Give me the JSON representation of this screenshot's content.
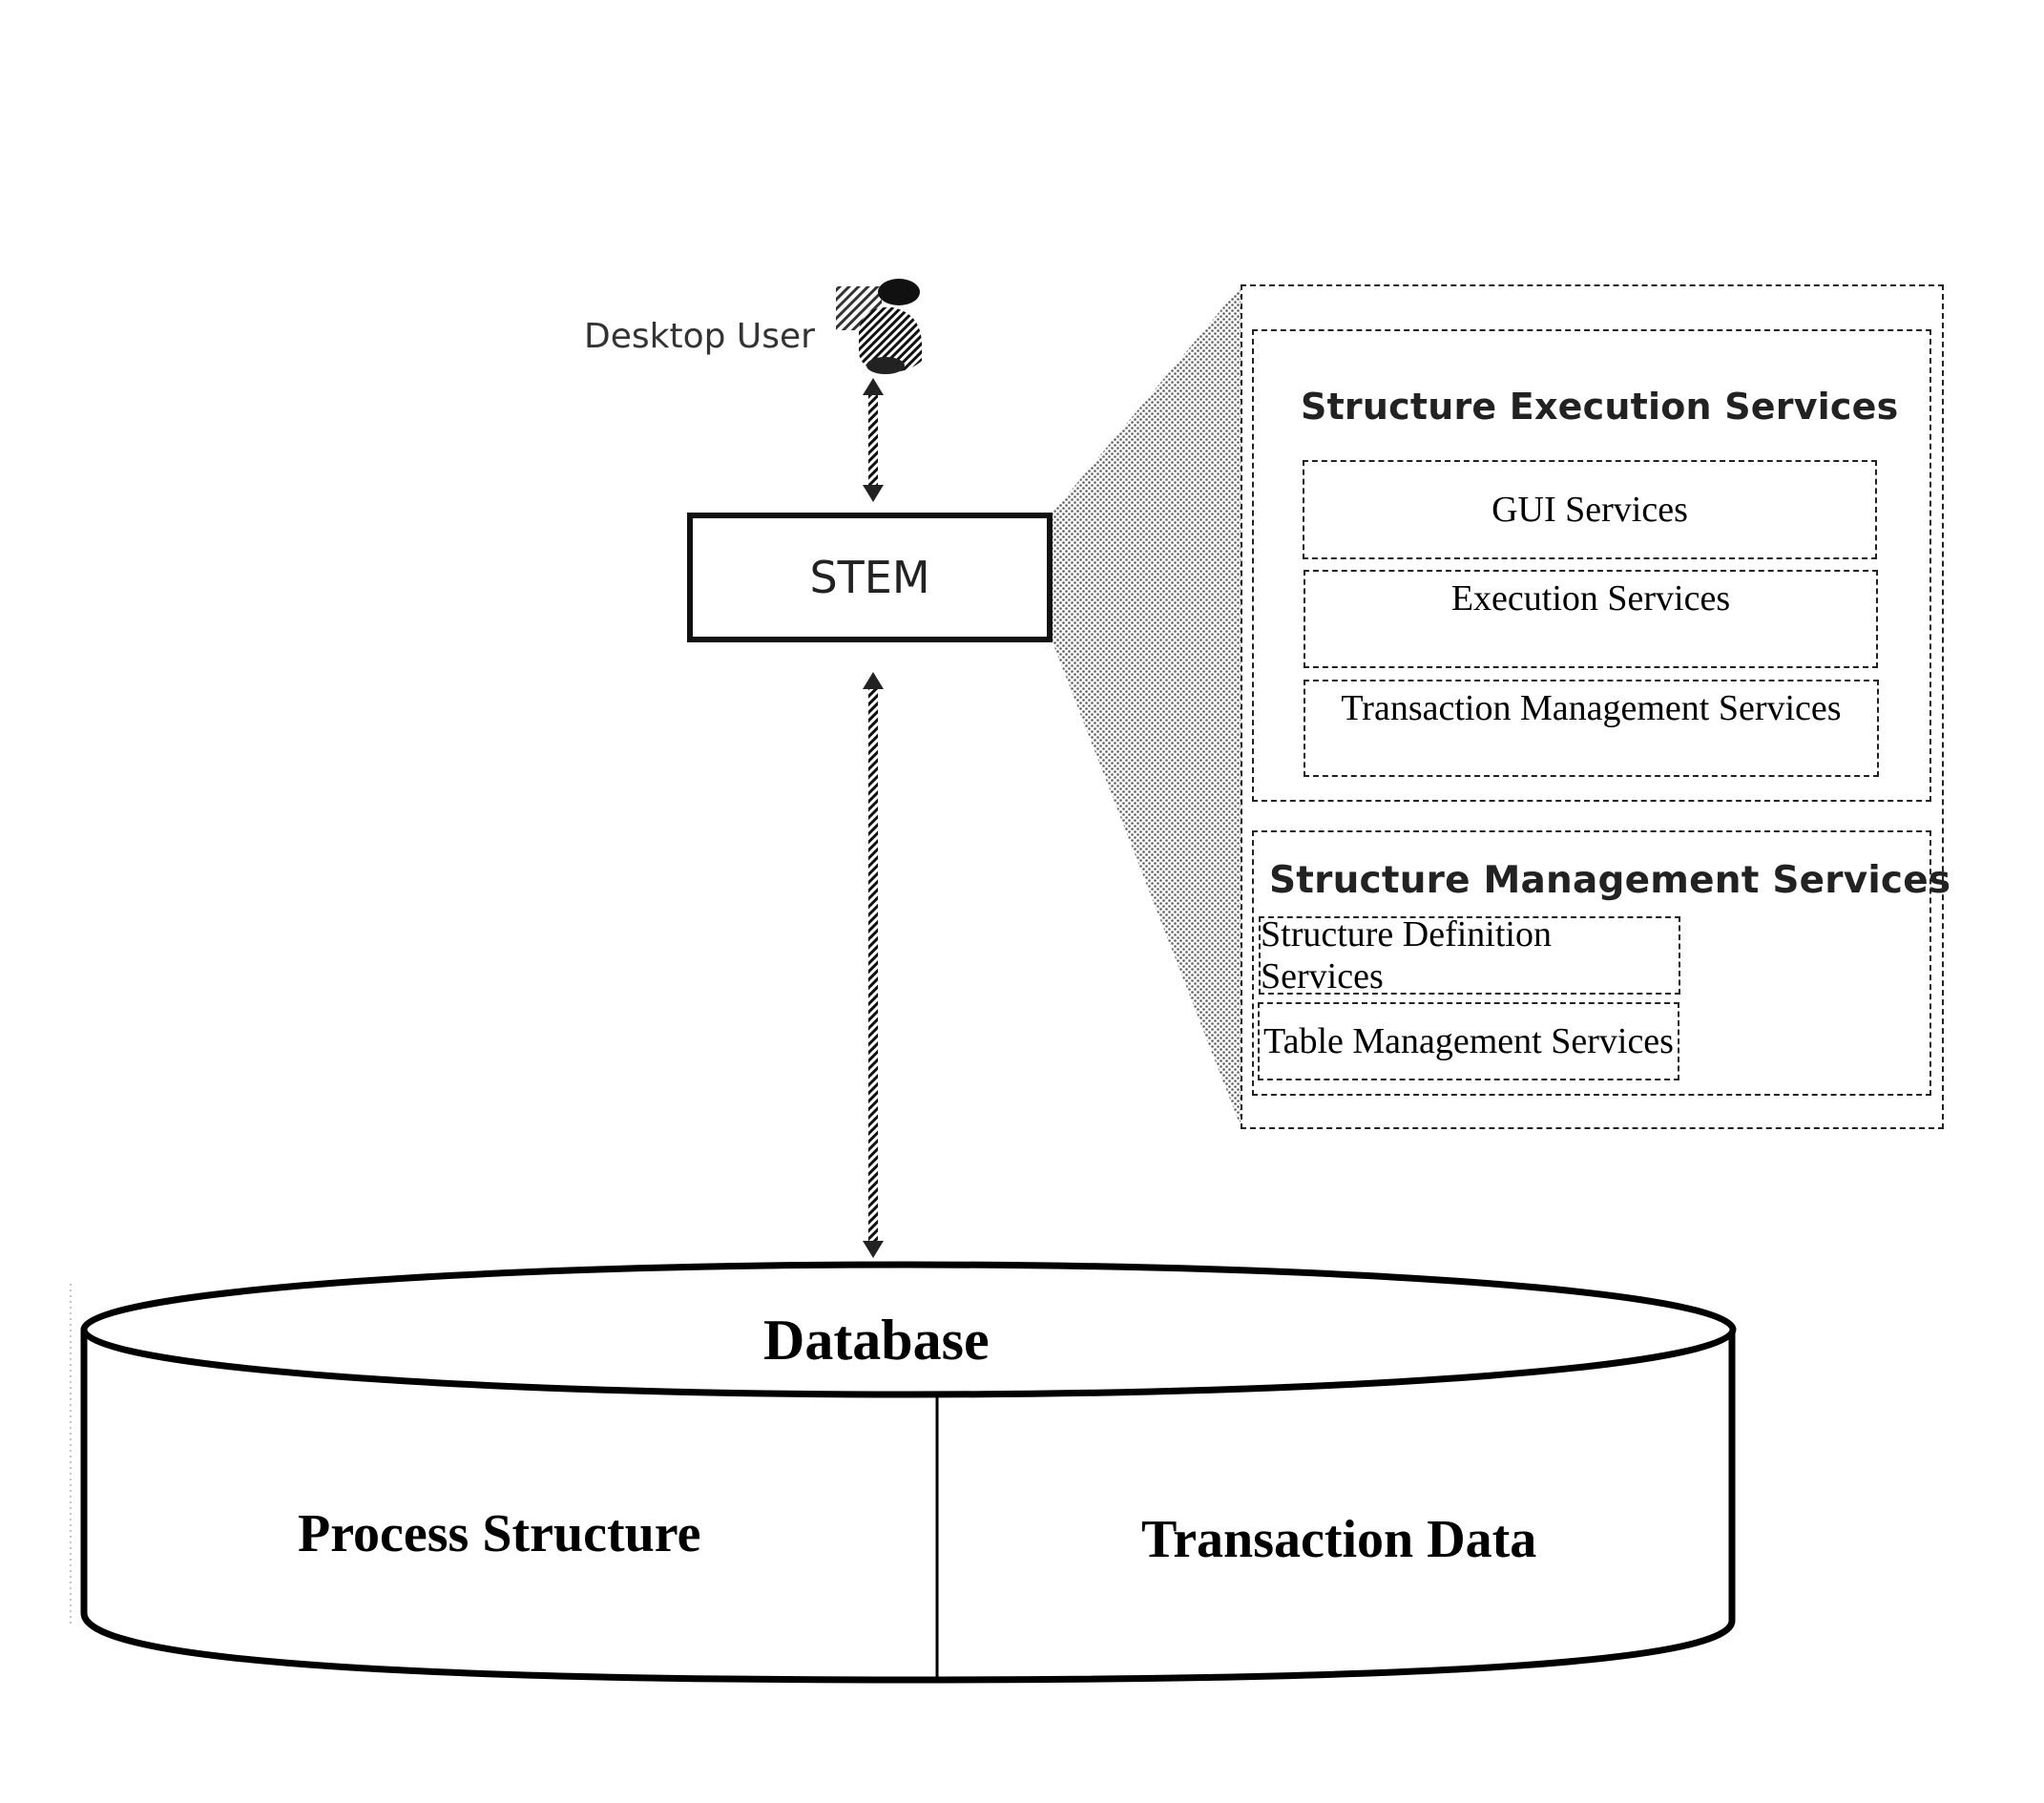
{
  "diagram": {
    "actor": {
      "label": "Desktop User",
      "icon": "desktop-user-icon"
    },
    "core_component": {
      "label": "STEM"
    },
    "connections": [
      {
        "from": "Desktop User",
        "to": "STEM",
        "type": "bidirectional-arrow"
      },
      {
        "from": "STEM",
        "to": "Database",
        "type": "bidirectional-arrow"
      }
    ],
    "stem_detail": {
      "groups": [
        {
          "title": "Structure Execution Services",
          "services": [
            "GUI Services",
            "Execution Services",
            "Transaction Management Services"
          ]
        },
        {
          "title": "Structure Management Services",
          "services": [
            "Structure Definition Services",
            "Table Management Services"
          ]
        }
      ]
    },
    "database": {
      "title": "Database",
      "partitions": [
        "Process Structure",
        "Transaction Data"
      ]
    }
  },
  "colors": {
    "ink": "#000000",
    "background": "#ffffff",
    "callout_shade": "#9a9a9a"
  }
}
